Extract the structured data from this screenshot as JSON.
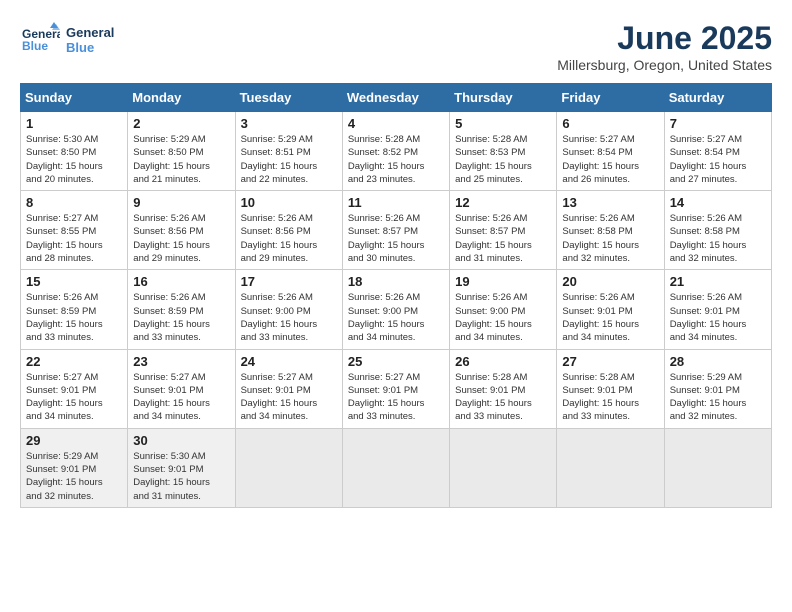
{
  "header": {
    "logo_line1": "General",
    "logo_line2": "Blue",
    "month_title": "June 2025",
    "location": "Millersburg, Oregon, United States"
  },
  "weekdays": [
    "Sunday",
    "Monday",
    "Tuesday",
    "Wednesday",
    "Thursday",
    "Friday",
    "Saturday"
  ],
  "weeks": [
    [
      {
        "day": "1",
        "info": "Sunrise: 5:30 AM\nSunset: 8:50 PM\nDaylight: 15 hours\nand 20 minutes."
      },
      {
        "day": "2",
        "info": "Sunrise: 5:29 AM\nSunset: 8:50 PM\nDaylight: 15 hours\nand 21 minutes."
      },
      {
        "day": "3",
        "info": "Sunrise: 5:29 AM\nSunset: 8:51 PM\nDaylight: 15 hours\nand 22 minutes."
      },
      {
        "day": "4",
        "info": "Sunrise: 5:28 AM\nSunset: 8:52 PM\nDaylight: 15 hours\nand 23 minutes."
      },
      {
        "day": "5",
        "info": "Sunrise: 5:28 AM\nSunset: 8:53 PM\nDaylight: 15 hours\nand 25 minutes."
      },
      {
        "day": "6",
        "info": "Sunrise: 5:27 AM\nSunset: 8:54 PM\nDaylight: 15 hours\nand 26 minutes."
      },
      {
        "day": "7",
        "info": "Sunrise: 5:27 AM\nSunset: 8:54 PM\nDaylight: 15 hours\nand 27 minutes."
      }
    ],
    [
      {
        "day": "8",
        "info": "Sunrise: 5:27 AM\nSunset: 8:55 PM\nDaylight: 15 hours\nand 28 minutes."
      },
      {
        "day": "9",
        "info": "Sunrise: 5:26 AM\nSunset: 8:56 PM\nDaylight: 15 hours\nand 29 minutes."
      },
      {
        "day": "10",
        "info": "Sunrise: 5:26 AM\nSunset: 8:56 PM\nDaylight: 15 hours\nand 29 minutes."
      },
      {
        "day": "11",
        "info": "Sunrise: 5:26 AM\nSunset: 8:57 PM\nDaylight: 15 hours\nand 30 minutes."
      },
      {
        "day": "12",
        "info": "Sunrise: 5:26 AM\nSunset: 8:57 PM\nDaylight: 15 hours\nand 31 minutes."
      },
      {
        "day": "13",
        "info": "Sunrise: 5:26 AM\nSunset: 8:58 PM\nDaylight: 15 hours\nand 32 minutes."
      },
      {
        "day": "14",
        "info": "Sunrise: 5:26 AM\nSunset: 8:58 PM\nDaylight: 15 hours\nand 32 minutes."
      }
    ],
    [
      {
        "day": "15",
        "info": "Sunrise: 5:26 AM\nSunset: 8:59 PM\nDaylight: 15 hours\nand 33 minutes."
      },
      {
        "day": "16",
        "info": "Sunrise: 5:26 AM\nSunset: 8:59 PM\nDaylight: 15 hours\nand 33 minutes."
      },
      {
        "day": "17",
        "info": "Sunrise: 5:26 AM\nSunset: 9:00 PM\nDaylight: 15 hours\nand 33 minutes."
      },
      {
        "day": "18",
        "info": "Sunrise: 5:26 AM\nSunset: 9:00 PM\nDaylight: 15 hours\nand 34 minutes."
      },
      {
        "day": "19",
        "info": "Sunrise: 5:26 AM\nSunset: 9:00 PM\nDaylight: 15 hours\nand 34 minutes."
      },
      {
        "day": "20",
        "info": "Sunrise: 5:26 AM\nSunset: 9:01 PM\nDaylight: 15 hours\nand 34 minutes."
      },
      {
        "day": "21",
        "info": "Sunrise: 5:26 AM\nSunset: 9:01 PM\nDaylight: 15 hours\nand 34 minutes."
      }
    ],
    [
      {
        "day": "22",
        "info": "Sunrise: 5:27 AM\nSunset: 9:01 PM\nDaylight: 15 hours\nand 34 minutes."
      },
      {
        "day": "23",
        "info": "Sunrise: 5:27 AM\nSunset: 9:01 PM\nDaylight: 15 hours\nand 34 minutes."
      },
      {
        "day": "24",
        "info": "Sunrise: 5:27 AM\nSunset: 9:01 PM\nDaylight: 15 hours\nand 34 minutes."
      },
      {
        "day": "25",
        "info": "Sunrise: 5:27 AM\nSunset: 9:01 PM\nDaylight: 15 hours\nand 33 minutes."
      },
      {
        "day": "26",
        "info": "Sunrise: 5:28 AM\nSunset: 9:01 PM\nDaylight: 15 hours\nand 33 minutes."
      },
      {
        "day": "27",
        "info": "Sunrise: 5:28 AM\nSunset: 9:01 PM\nDaylight: 15 hours\nand 33 minutes."
      },
      {
        "day": "28",
        "info": "Sunrise: 5:29 AM\nSunset: 9:01 PM\nDaylight: 15 hours\nand 32 minutes."
      }
    ],
    [
      {
        "day": "29",
        "info": "Sunrise: 5:29 AM\nSunset: 9:01 PM\nDaylight: 15 hours\nand 32 minutes."
      },
      {
        "day": "30",
        "info": "Sunrise: 5:30 AM\nSunset: 9:01 PM\nDaylight: 15 hours\nand 31 minutes."
      },
      {
        "day": "",
        "info": ""
      },
      {
        "day": "",
        "info": ""
      },
      {
        "day": "",
        "info": ""
      },
      {
        "day": "",
        "info": ""
      },
      {
        "day": "",
        "info": ""
      }
    ]
  ]
}
